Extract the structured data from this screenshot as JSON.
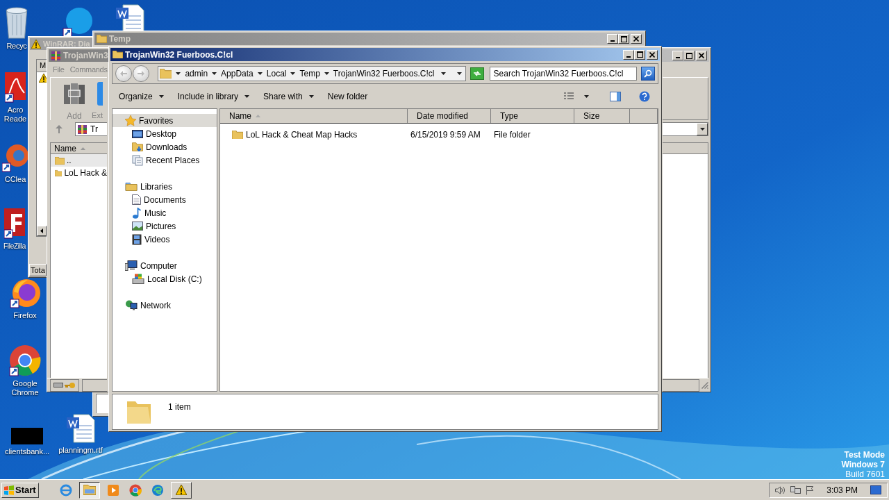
{
  "desktop": {
    "icons": [
      {
        "kind": "recycle",
        "label": "Recyc"
      },
      {
        "kind": "chat"
      },
      {
        "kind": "word"
      },
      {
        "kind": "acrobat",
        "label": "Acro Reade"
      },
      {
        "kind": "ccleaner",
        "label": "CClea"
      },
      {
        "kind": "filezilla",
        "label": "FileZilla"
      },
      {
        "kind": "firefox",
        "label": "Firefox"
      },
      {
        "kind": "chrome",
        "label": "Google Chrome"
      },
      {
        "kind": "blank",
        "label": "clientsbank..."
      },
      {
        "kind": "word",
        "label": "planningm.rtf"
      }
    ],
    "build_info": [
      "Test Mode",
      "Windows 7",
      "Build 7601"
    ]
  },
  "dialog_window": {
    "title": "WinRAR: Dia",
    "column": "M",
    "button": "Tota"
  },
  "temp_window": {
    "title": "Temp"
  },
  "archive_window": {
    "title": "TrojanWin3",
    "menu": [
      "File",
      "Commands"
    ],
    "toolbar": [
      "Add",
      "Ext"
    ],
    "address": "Tr",
    "column": "Name",
    "rows": [
      {
        "name": ".."
      },
      {
        "name": "LoL Hack &"
      }
    ]
  },
  "explorer": {
    "title": "TrojanWin32 Fuerboos.C!cl",
    "breadcrumb": [
      "admin",
      "AppData",
      "Local",
      "Temp",
      "TrojanWin32 Fuerboos.C!cl"
    ],
    "search": {
      "placeholder": "Search TrojanWin32 Fuerboos.C!cl"
    },
    "commands": [
      {
        "label": "Organize",
        "dropdown": true
      },
      {
        "label": "Include in library",
        "dropdown": true
      },
      {
        "label": "Share with",
        "dropdown": true
      },
      {
        "label": "New folder",
        "dropdown": false
      }
    ],
    "nav_pane": [
      {
        "label": "Favorites",
        "selected": true,
        "children": [
          {
            "label": "Desktop",
            "selected": false
          },
          {
            "label": "Downloads",
            "selected": false
          },
          {
            "label": "Recent Places",
            "selected": false
          }
        ]
      },
      {
        "label": "Libraries",
        "selected": false,
        "children": [
          {
            "label": "Documents",
            "selected": false
          },
          {
            "label": "Music",
            "selected": false
          },
          {
            "label": "Pictures",
            "selected": false
          },
          {
            "label": "Videos",
            "selected": false
          }
        ]
      },
      {
        "label": "Computer",
        "selected": false,
        "children": [
          {
            "label": "Local Disk (C:)",
            "selected": false
          }
        ]
      },
      {
        "label": "Network",
        "selected": false
      }
    ],
    "columns": [
      "Name",
      "Date modified",
      "Type",
      "Size"
    ],
    "rows": [
      {
        "name": "LoL Hack & Cheat Map Hacks",
        "date_modified": "6/15/2019 9:59 AM",
        "type": "File folder"
      }
    ],
    "details": "1 item"
  },
  "taskbar": {
    "start": "Start",
    "apps": [
      {
        "kind": "ie",
        "selected": false,
        "running": false
      },
      {
        "kind": "explorer",
        "selected": true,
        "running": true
      },
      {
        "kind": "media",
        "selected": false,
        "running": false
      },
      {
        "kind": "chrome",
        "selected": false,
        "running": false
      },
      {
        "kind": "edge",
        "selected": false,
        "running": false
      },
      {
        "kind": "warning",
        "selected": false,
        "running": true
      }
    ],
    "clock": "3:03 PM"
  }
}
